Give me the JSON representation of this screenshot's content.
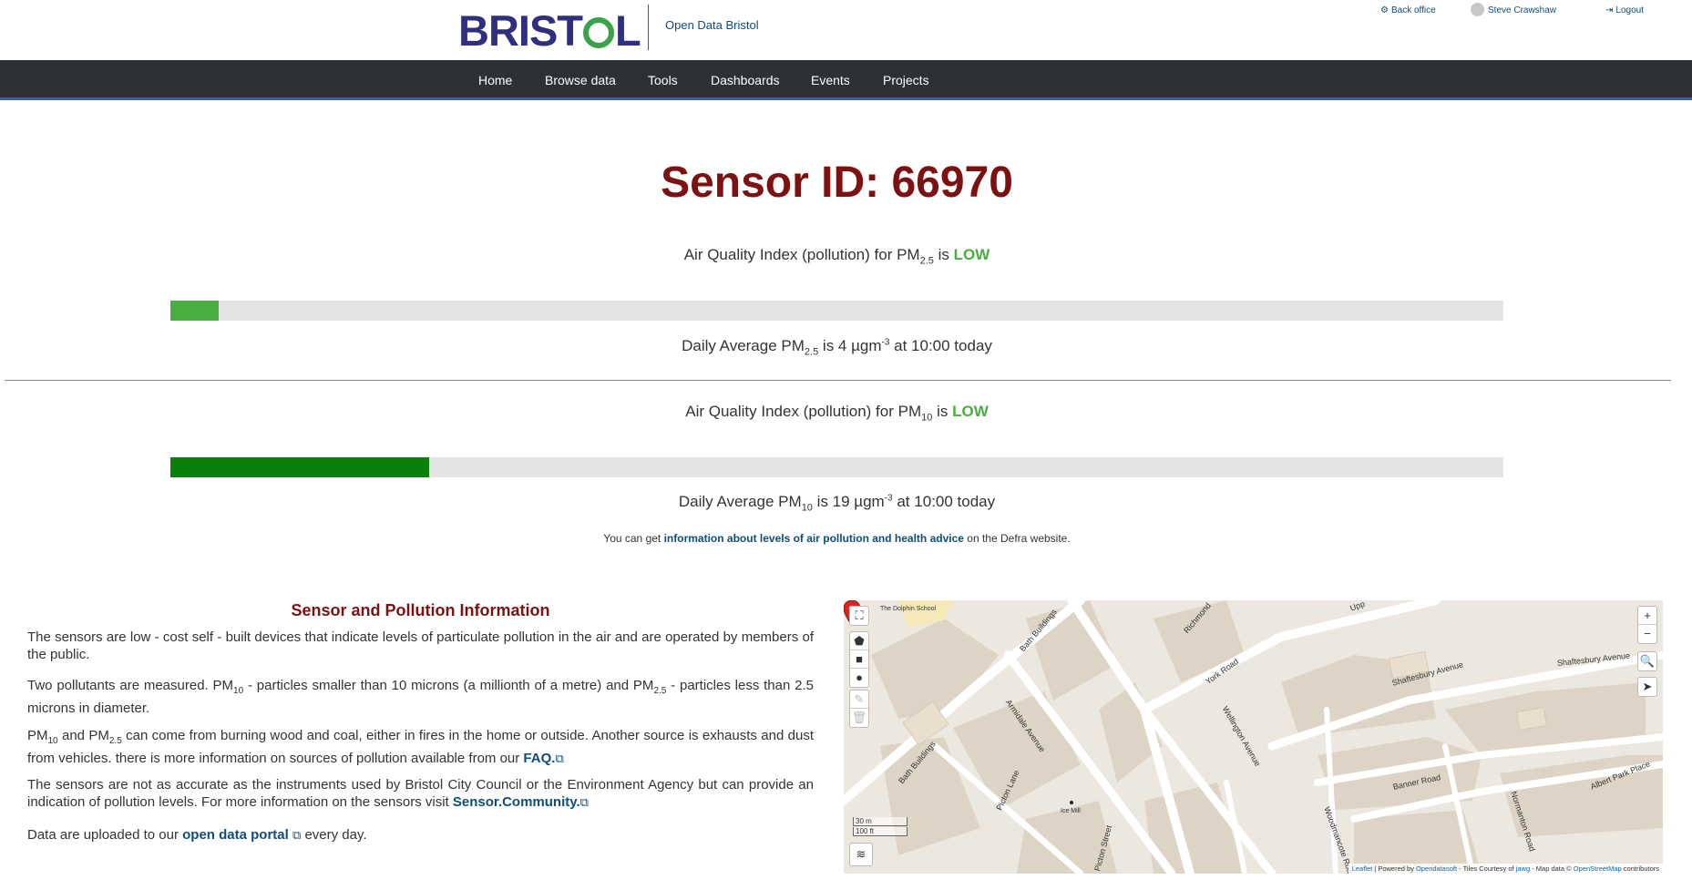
{
  "header": {
    "logo": {
      "left": "BRIST",
      "right": "L"
    },
    "site_name": "Open Data Bristol",
    "back_office": "Back office",
    "user_name": "Steve Crawshaw",
    "logout": "Logout"
  },
  "nav": [
    "Home",
    "Browse data",
    "Tools",
    "Dashboards",
    "Events",
    "Projects"
  ],
  "sensor": {
    "title": "Sensor ID: 66970",
    "pm25": {
      "aqi_prefix": "Air Quality Index (pollution) for PM",
      "sub": "2.5",
      "aqi_mid": " is ",
      "level": "LOW",
      "level_fraction": 0.036,
      "bar_color": "#47ae3f",
      "avg_prefix": "Daily Average PM",
      "avg_value": " is 4 µgm",
      "avg_sup": "-3",
      "avg_suffix": " at 10:00 today"
    },
    "pm10": {
      "aqi_prefix": "Air Quality Index (pollution) for PM",
      "sub": "10",
      "aqi_mid": " is ",
      "level": "LOW",
      "level_fraction": 0.194,
      "bar_color": "#0a7f0a",
      "avg_prefix": "Daily Average PM",
      "avg_value": " is 19 µgm",
      "avg_sup": "-3",
      "avg_suffix": " at 10:00 today"
    },
    "defra_prefix": "You can get ",
    "defra_link": "information about levels of air pollution and health advice",
    "defra_suffix": " on the Defra website."
  },
  "info": {
    "title": "Sensor and Pollution Information",
    "p1": "The sensors are low - cost self - built devices that indicate levels of particulate pollution in the air and are operated by members of the public.",
    "p2_a": "Two pollutants are measured. PM",
    "p2_sub1": "10",
    "p2_b": " - particles smaller than 10 microns (a millionth of a metre) and PM",
    "p2_sub2": "2.5",
    "p2_c": " - particles less than 2.5 microns in diameter.",
    "p3_a": "PM",
    "p3_sub1": "10",
    "p3_b": " and PM",
    "p3_sub2": "2.5",
    "p3_c": " can come from burning wood and coal, either in fires in the home or outside. Another source is exhausts and dust from vehicles. there is more information on sources of pollution available from our ",
    "p3_link": "FAQ.",
    "p4_a": "The sensors are not as accurate as the instruments used by Bristol City Council or the Environment Agency but can provide an indication of pollution levels. For more information on the sensors visit ",
    "p4_link": "Sensor.Community.",
    "p5_a": "Data are uploaded to our ",
    "p5_link": "open data portal",
    "p5_b": " every day."
  },
  "map": {
    "zoom_in": "+",
    "zoom_out": "−",
    "scale_m": "30 m",
    "scale_ft": "100 ft",
    "labels": [
      "The Dolphin School",
      "Bath Buildings",
      "Richmond",
      "Armidale Avenue",
      "York Road",
      "Wellington Avenue",
      "Shaftesbury Avenue",
      "Shaftesbury Avenue",
      "Bath Buildings",
      "Picton Lane",
      "Ice Mill",
      "Picton Street",
      "Banner Road",
      "Woodmancote Road",
      "Normanton Road",
      "Albert Park Place",
      "Upp"
    ],
    "attribution": {
      "leaflet": "Leaflet",
      "powered": " | Powered by ",
      "ods": "Opendatasoft",
      "tiles": " - Tiles Courtesy of ",
      "jawg": "jawg",
      "mapdata": " - Map data © ",
      "osm": "OpenStreetMap",
      "contrib": " contributors"
    }
  }
}
